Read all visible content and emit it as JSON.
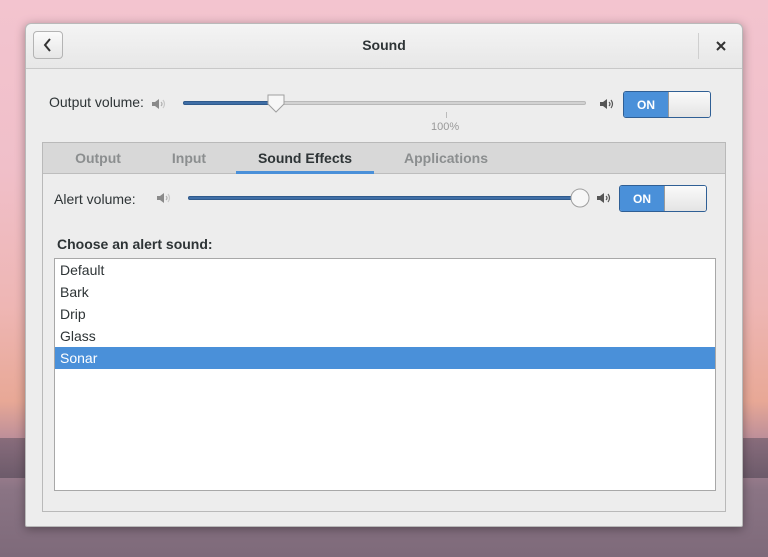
{
  "window": {
    "title": "Sound"
  },
  "output": {
    "label": "Output volume:",
    "volume": 0.23,
    "mark_label": "100%",
    "switch_label": "ON"
  },
  "tabs": [
    {
      "label": "Output",
      "active": false
    },
    {
      "label": "Input",
      "active": false
    },
    {
      "label": "Sound Effects",
      "active": true
    },
    {
      "label": "Applications",
      "active": false
    }
  ],
  "sound_effects": {
    "alert_label": "Alert volume:",
    "alert_volume": 1.0,
    "switch_label": "ON",
    "choose_label": "Choose an alert sound:",
    "sounds": [
      "Default",
      "Bark",
      "Drip",
      "Glass",
      "Sonar"
    ],
    "selected": "Sonar"
  },
  "icons": {
    "back": "chevron-left-icon",
    "close": "close-icon",
    "volume_low": "speaker-low-icon",
    "volume_high": "speaker-high-icon"
  },
  "colors": {
    "accent": "#4a90d9",
    "slider_fill": "#3f6ea6"
  }
}
